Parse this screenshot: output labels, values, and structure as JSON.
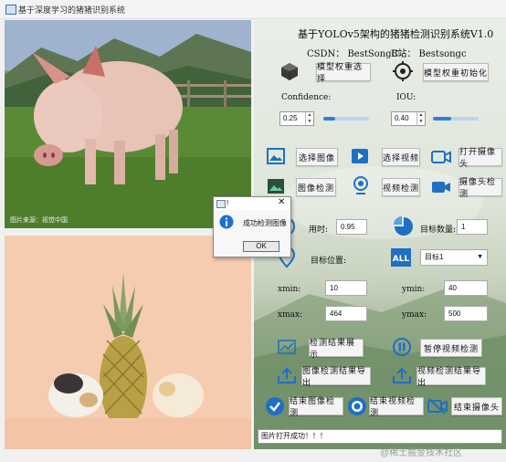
{
  "window": {
    "title": "基于深度学习的猪猪识别系统"
  },
  "header": {
    "title": "基于YOLOv5架构的猪猪检测识别系统V1.0",
    "csdn": "CSDN：  BestSongC",
    "bilibili": "B站：  Bestsongc"
  },
  "model": {
    "select_label": "模型权重选择",
    "init_label": "模型权重初始化"
  },
  "params": {
    "confidence_label": "Confidence:",
    "confidence_value": "0.25",
    "confidence_fraction": 0.25,
    "iou_label": "IOU:",
    "iou_value": "0.40",
    "iou_fraction": 0.4
  },
  "sources": {
    "select_image": "选择图像",
    "select_video": "选择视频",
    "open_camera": "打开摄像头",
    "image_detect": "图像检测",
    "video_detect": "视频检测",
    "camera_detect": "摄像头检测"
  },
  "results": {
    "time_label": "用时:",
    "time_value": "0.95",
    "count_label": "目标数量:",
    "count_value": "1",
    "position_label": "目标位置:",
    "target_select": "目标1",
    "xmin_label": "xmin:",
    "xmin_value": "10",
    "ymin_label": "ymin:",
    "ymin_value": "40",
    "xmax_label": "xmax:",
    "xmax_value": "464",
    "ymax_label": "ymax:",
    "ymax_value": "500"
  },
  "actions": {
    "show_results": "检测结果展示",
    "pause_video": "暂停视频检测",
    "export_image_results": "图像检测结果导出",
    "export_video_results": "视频检测结果导出",
    "end_image_detect": "结束图像检测",
    "end_video_detect": "结束视频检测",
    "end_camera": "结束摄像头"
  },
  "status": {
    "message": "图片打开成功！！！"
  },
  "dialog": {
    "title": "!",
    "message": "成功检测图像",
    "ok_label": "OK"
  },
  "watermark": "@稀土掘金技术社区",
  "image_caption": "图片来源：视觉中国"
}
